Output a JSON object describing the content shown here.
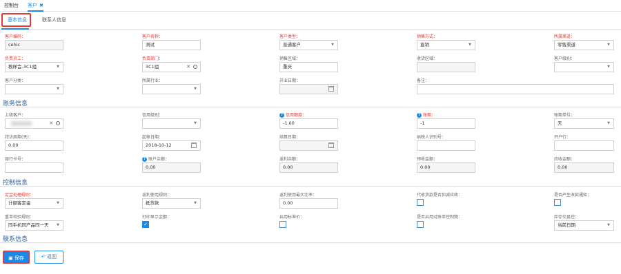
{
  "tabs": {
    "console": "控制台",
    "customer": "客户",
    "close": "✖"
  },
  "subtabs": {
    "basic": "基本信息",
    "contacts": "联系人信息"
  },
  "sections": {
    "account": "账务信息",
    "control": "控制信息",
    "contact": "联系信息"
  },
  "basic": {
    "code": {
      "label": "客户编码：",
      "value": "cehic"
    },
    "name": {
      "label": "客户名称：",
      "value": "测试"
    },
    "type": {
      "label": "客户类型：",
      "value": "普通客户"
    },
    "salemode": {
      "label": "销售方式：",
      "value": "直销"
    },
    "channel": {
      "label": "所属渠道：",
      "value": "零售渠道"
    },
    "staff": {
      "label": "负责员工：",
      "value": "教样会-3C1组"
    },
    "dept": {
      "label": "负责部门：",
      "value": "3C1组"
    },
    "salearea": {
      "label": "销售区域：",
      "value": "重庆"
    },
    "recvarea": {
      "label": "收货区域：",
      "value": ""
    },
    "level": {
      "label": "客户级别：",
      "value": ""
    },
    "category": {
      "label": "客户分类：",
      "value": ""
    },
    "industry": {
      "label": "所属行业：",
      "value": ""
    },
    "opendate": {
      "label": "开业日期：",
      "value": ""
    },
    "remark": {
      "label": "备注：",
      "value": ""
    }
  },
  "account": {
    "parent": {
      "label": "上级客户：",
      "value": ""
    },
    "credit_level": {
      "label": "信用级别：",
      "value": ""
    },
    "credit_limit": {
      "label": "信用额度：",
      "value": "-1.00"
    },
    "term": {
      "label": "账期：",
      "value": "-1"
    },
    "term_unit": {
      "label": "账期单位：",
      "value": "天"
    },
    "visit": {
      "label": "拜访周期(天)：",
      "value": "0.00"
    },
    "acc_date": {
      "label": "起帐日期：",
      "value": "2018-10-12"
    },
    "settle_date": {
      "label": "结算日期：",
      "value": ""
    },
    "taxno": {
      "label": "纳税人识别号：",
      "value": ""
    },
    "bank": {
      "label": "开户行：",
      "value": ""
    },
    "card": {
      "label": "银行卡号：",
      "value": ""
    },
    "balance": {
      "label": "账户余额：",
      "value": "0.00"
    },
    "rebate": {
      "label": "返利余额：",
      "value": "0.00"
    },
    "prepay": {
      "label": "预收金额：",
      "value": "0.00"
    },
    "receivable": {
      "label": "应收金额：",
      "value": "0.00"
    }
  },
  "control": {
    "pricing": {
      "label": "定金处理规则：",
      "value": "计额客定金"
    },
    "rebate_rule": {
      "label": "返利使用规则：",
      "value": "抵货款"
    },
    "rebate_max": {
      "label": "返利使用最大比率：",
      "value": "0.00"
    },
    "collect_offset": {
      "label": "代收货款是否扣减应收：",
      "checked": false
    },
    "gen_notice": {
      "label": "是否产生收款通知：",
      "checked": false
    },
    "serial_rule": {
      "label": "重单校验规则：",
      "value": "同手机同产品同一天"
    },
    "print_amount": {
      "label": "打印显示金额：",
      "checked": true
    },
    "std_price": {
      "label": "启用标准价：",
      "checked": false
    },
    "use_price_ctrl": {
      "label": "是否启用对账单控制物：",
      "checked": false
    },
    "stock_date": {
      "label": "库存交易控：",
      "value": "当前日期"
    }
  },
  "buttons": {
    "save": "保存",
    "back": "返回"
  },
  "colors": {
    "accent": "#1e88e5",
    "required": "#e53935",
    "section": "#2a5fa8"
  }
}
